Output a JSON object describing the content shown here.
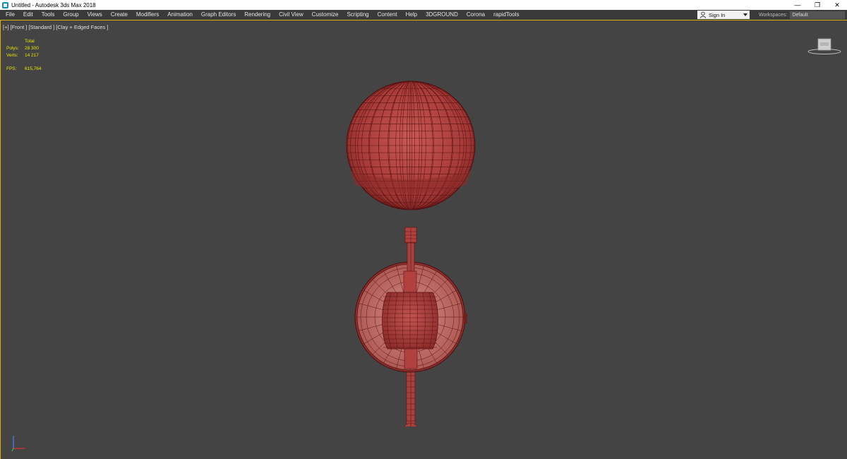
{
  "window": {
    "title": "Untitled - Autodesk 3ds Max 2018",
    "min_glyph": "—",
    "max_glyph": "❐",
    "close_glyph": "✕"
  },
  "menu": {
    "items": [
      "File",
      "Edit",
      "Tools",
      "Group",
      "Views",
      "Create",
      "Modifiers",
      "Animation",
      "Graph Editors",
      "Rendering",
      "Civil View",
      "Customize",
      "Scripting",
      "Content",
      "Help",
      "3DGROUND",
      "Corona",
      "rapidTools"
    ]
  },
  "signin": {
    "label": "Sign In",
    "icon": "user-icon"
  },
  "workspaces": {
    "label": "Workspaces:",
    "value": "Default"
  },
  "viewport": {
    "label": "[+] [Front ] [Standard ] [Clay + Edged Faces ]",
    "stats": {
      "header": "Total",
      "polys_label": "Polys:",
      "polys_value": "28 300",
      "verts_label": "Verts:",
      "verts_value": "14 217",
      "fps_label": "FPS:",
      "fps_value": "615,764"
    }
  },
  "colors": {
    "viewport_bg": "#444444",
    "model_fill": "#b0413e",
    "wire": "#5a1212",
    "stats_text": "#e6e600",
    "active_border": "#d6b400"
  }
}
